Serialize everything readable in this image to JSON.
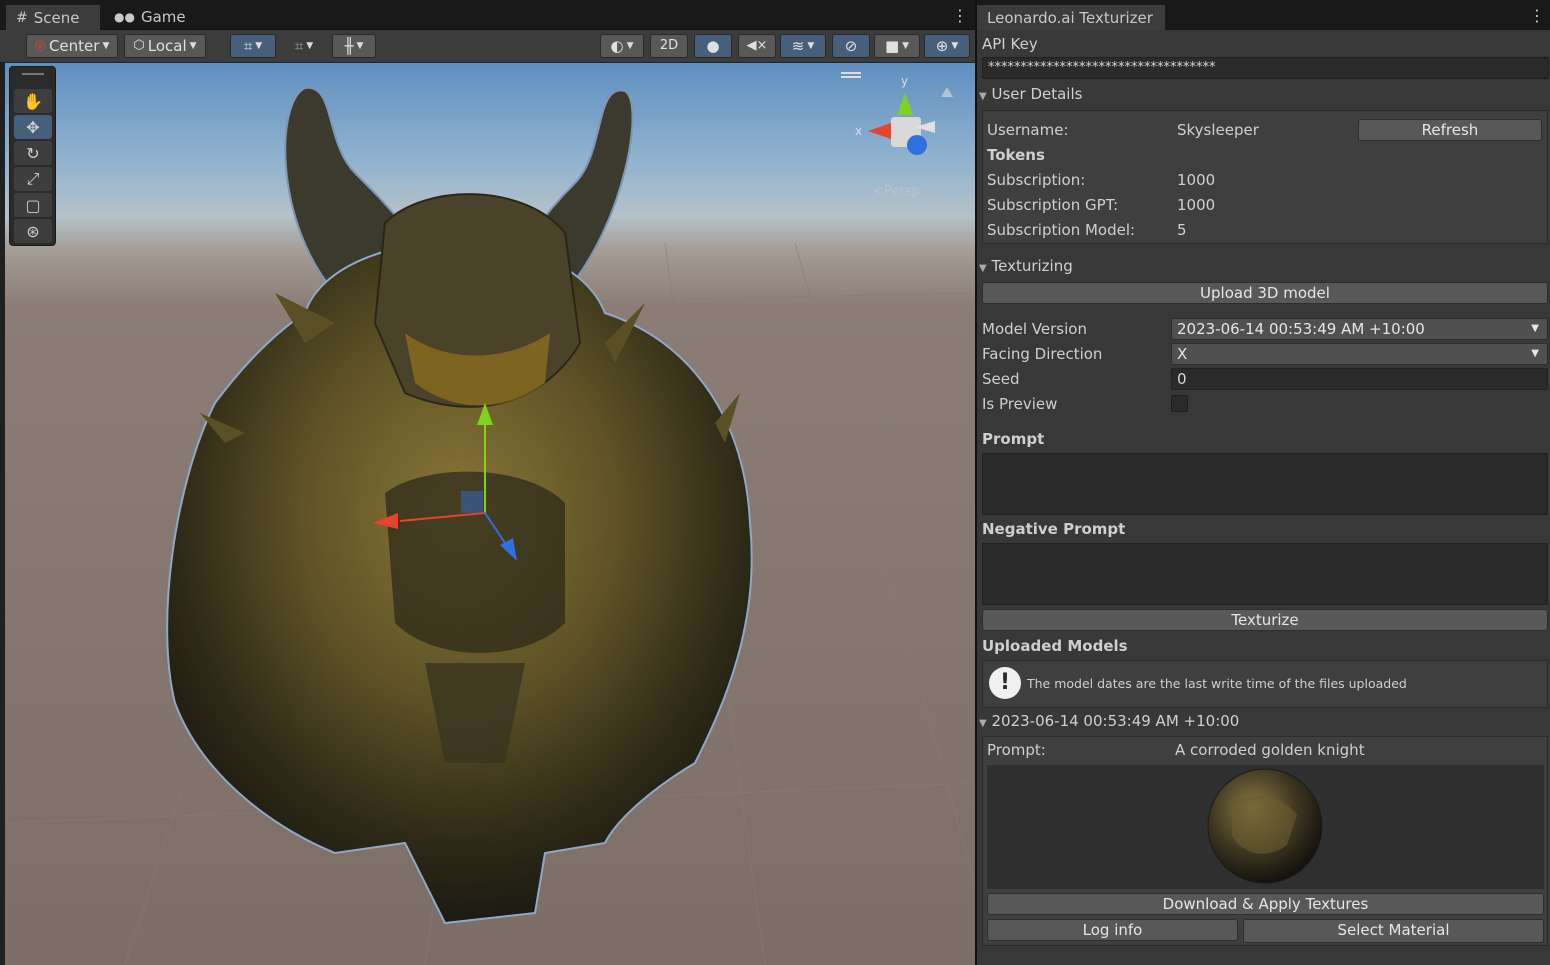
{
  "scene_tabs": {
    "scene": "Scene",
    "game": "Game"
  },
  "toolbar": {
    "center": "Center",
    "local": "Local",
    "two_d": "2D"
  },
  "gizmo": {
    "y": "y",
    "x": "x",
    "persp": "<Persp"
  },
  "colors": {
    "accent": "#46607c",
    "axis_x": "#e8432c",
    "axis_y": "#7ed321",
    "axis_z": "#2f6fe0"
  },
  "inspector": {
    "title": "Leonardo.ai Texturizer",
    "api_key_label": "API Key",
    "api_key_value": "***********************************",
    "user_details": {
      "header": "User Details",
      "username_label": "Username:",
      "username_value": "Skysleeper",
      "refresh": "Refresh",
      "tokens_label": "Tokens",
      "subscription_label": "Subscription:",
      "subscription_value": "1000",
      "subscription_gpt_label": "Subscription GPT:",
      "subscription_gpt_value": "1000",
      "subscription_model_label": "Subscription Model:",
      "subscription_model_value": "5"
    },
    "texturizing": {
      "header": "Texturizing",
      "upload": "Upload 3D model",
      "model_version_label": "Model Version",
      "model_version_value": "2023-06-14 00:53:49 AM +10:00",
      "facing_label": "Facing Direction",
      "facing_value": "X",
      "seed_label": "Seed",
      "seed_value": "0",
      "is_preview_label": "Is Preview",
      "prompt_label": "Prompt",
      "negative_label": "Negative Prompt",
      "texturize": "Texturize"
    },
    "uploaded": {
      "header": "Uploaded Models",
      "info": "The model dates are the last write time of the files uploaded",
      "item_header": "2023-06-14 00:53:49 AM +10:00",
      "prompt_label": "Prompt:",
      "prompt_value": "A corroded golden knight",
      "download": "Download & Apply Textures",
      "log_info": "Log info",
      "select_material": "Select Material"
    }
  }
}
